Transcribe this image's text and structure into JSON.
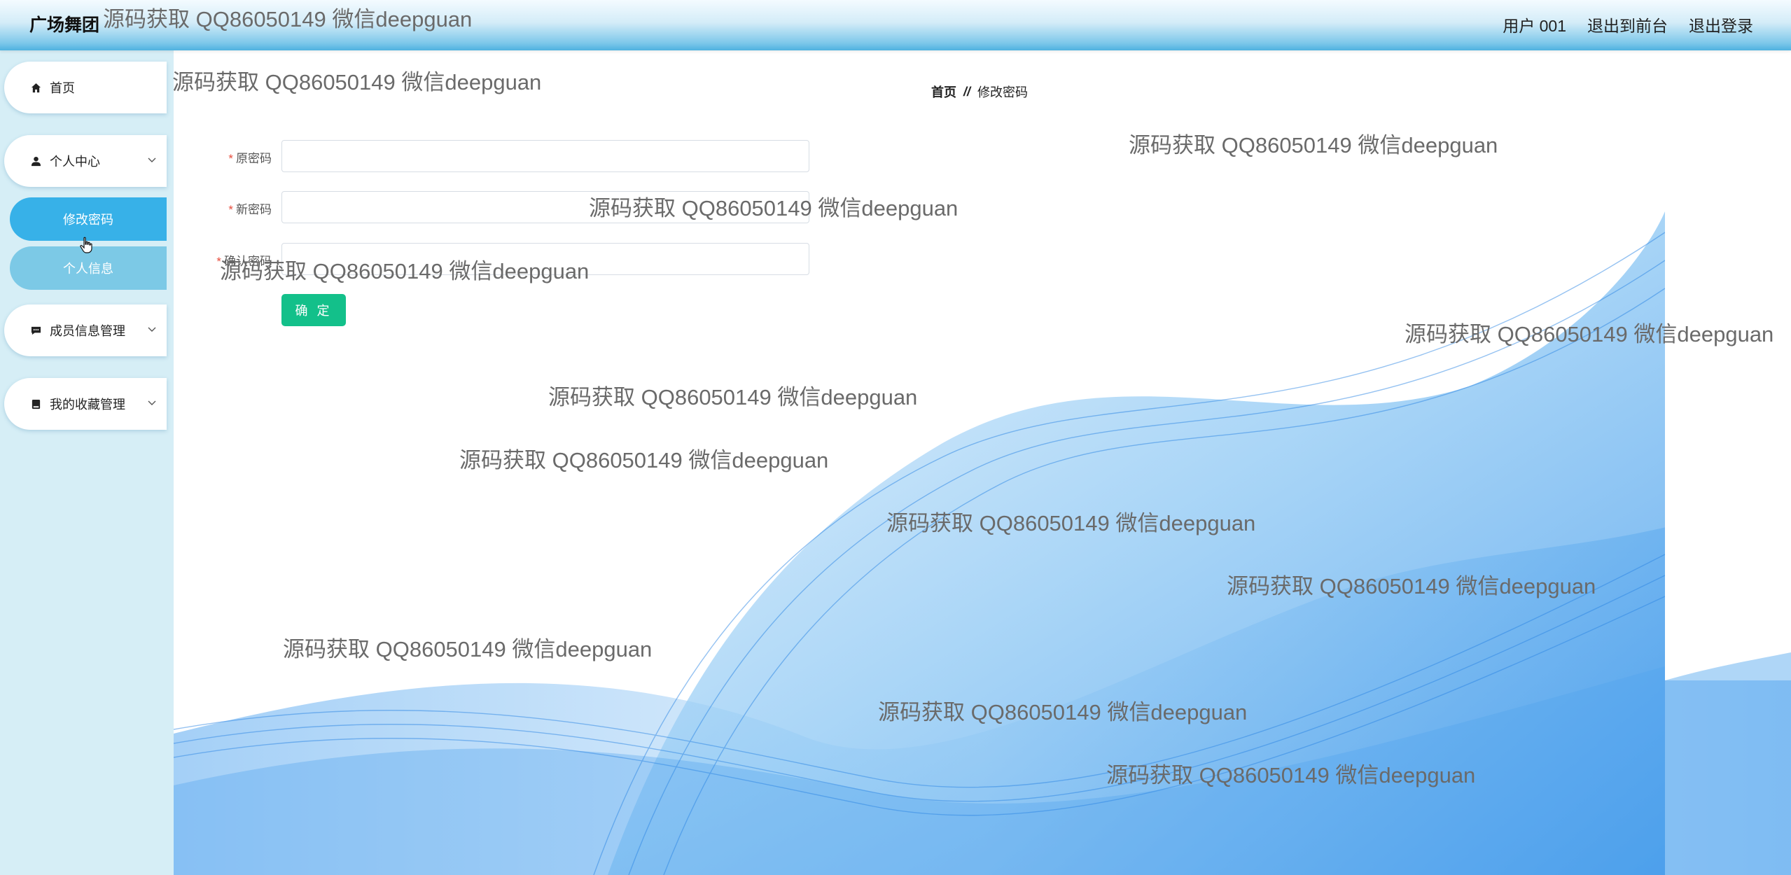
{
  "header": {
    "title": "广场舞团",
    "user": "用户 001",
    "to_front": "退出到前台",
    "logout": "退出登录"
  },
  "sidebar": {
    "home": "首页",
    "personal_center": "个人中心",
    "change_password": "修改密码",
    "personal_info": "个人信息",
    "member_mgmt": "成员信息管理",
    "favorites_mgmt": "我的收藏管理"
  },
  "breadcrumb": {
    "home": "首页",
    "separator": "//",
    "current": "修改密码"
  },
  "form": {
    "old_password_label": "原密码",
    "new_password_label": "新密码",
    "confirm_password_label": "确认密码",
    "required_mark": "*",
    "submit": "确 定",
    "old_password_value": "",
    "new_password_value": "",
    "confirm_password_value": ""
  },
  "watermark": "源码获取 QQ86050149 微信deepguan",
  "colors": {
    "active_menu": "#37b1e8",
    "submenu": "#7cc9e6",
    "sidebar_bg": "#d6eef6",
    "submit_button": "#13c08a",
    "wave_blue": "#2f8fe8"
  }
}
